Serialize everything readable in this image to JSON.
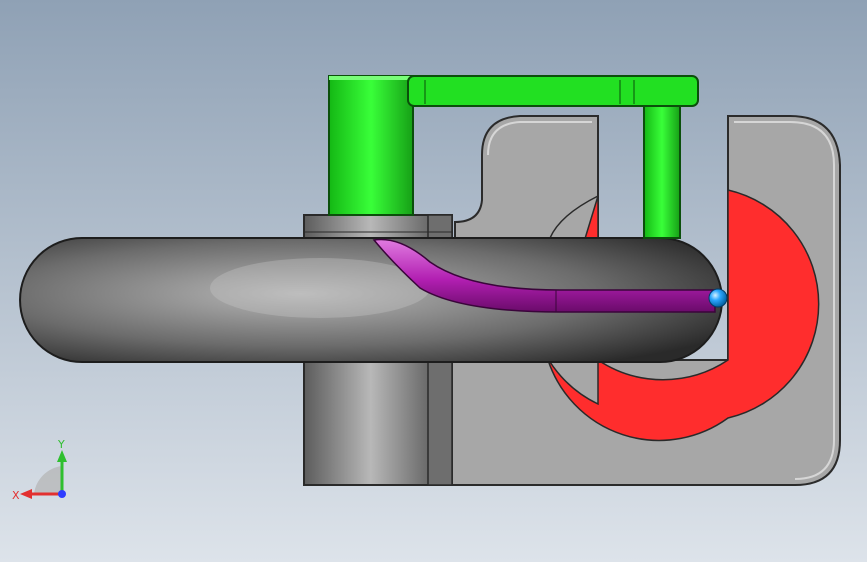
{
  "viewport": {
    "background_top": "#8fa1b5",
    "background_bottom": "#dde3ea"
  },
  "model": {
    "parts": [
      {
        "name": "base-block",
        "color": "#a7a7a7"
      },
      {
        "name": "cylinder-boss",
        "color": "#8a8a8a"
      },
      {
        "name": "red-ring",
        "color": "#ff2d2d"
      },
      {
        "name": "tube-body",
        "color": "#6d6d6d"
      },
      {
        "name": "magenta-channel",
        "color": "#b21fb2"
      },
      {
        "name": "green-bracket",
        "color": "#22e022"
      },
      {
        "name": "blue-ball",
        "color": "#2aa6ff"
      }
    ]
  },
  "triad": {
    "x_label": "X",
    "y_label": "Y",
    "x_color": "#e23030",
    "y_color": "#2fbf2f",
    "z_color": "#2e3cff"
  }
}
